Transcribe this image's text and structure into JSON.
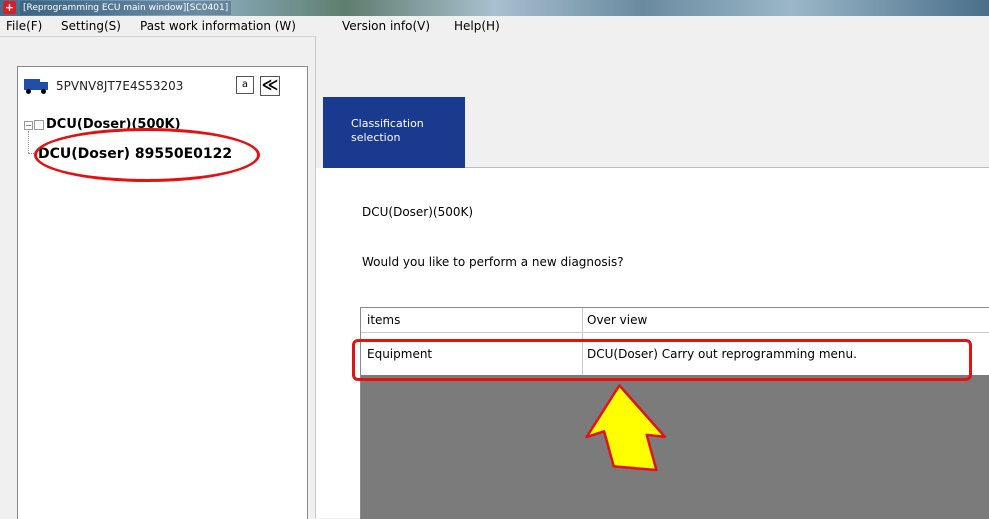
{
  "window": {
    "title": "[Reprogramming ECU main window][SC0401]",
    "app_icon": "app-logo-icon"
  },
  "menu": [
    {
      "label": "File(F)"
    },
    {
      "label": "Setting(S)"
    },
    {
      "label": "Past work information (W)"
    },
    {
      "label": "Version info(V)"
    },
    {
      "label": "Help(H)"
    }
  ],
  "left_panel": {
    "vehicle_icon": "truck-icon",
    "vin": "5PVNV8JT7E4S53203",
    "btn_a_label": "a",
    "btn_collapse_label": "≪",
    "tree": {
      "root_label": "DCU(Doser)(500K)",
      "child_label": "DCU(Doser) 89550E0122"
    }
  },
  "tabs": [
    {
      "label": "Classification\nselection",
      "active": true
    }
  ],
  "main": {
    "heading": "DCU(Doser)(500K)",
    "question": "Would you like to perform a new diagnosis?",
    "table": {
      "headers": [
        "items",
        "Over view"
      ],
      "rows": [
        {
          "items": "Equipment",
          "overview": "DCU(Doser) Carry out reprogramming menu."
        }
      ]
    }
  },
  "annotations": {
    "highlight_color": "#e21212",
    "arrow_color": "#ffff00"
  },
  "colors": {
    "tab_active_bg": "#1a3a8f",
    "table_empty_bg": "#7b7b7b"
  }
}
